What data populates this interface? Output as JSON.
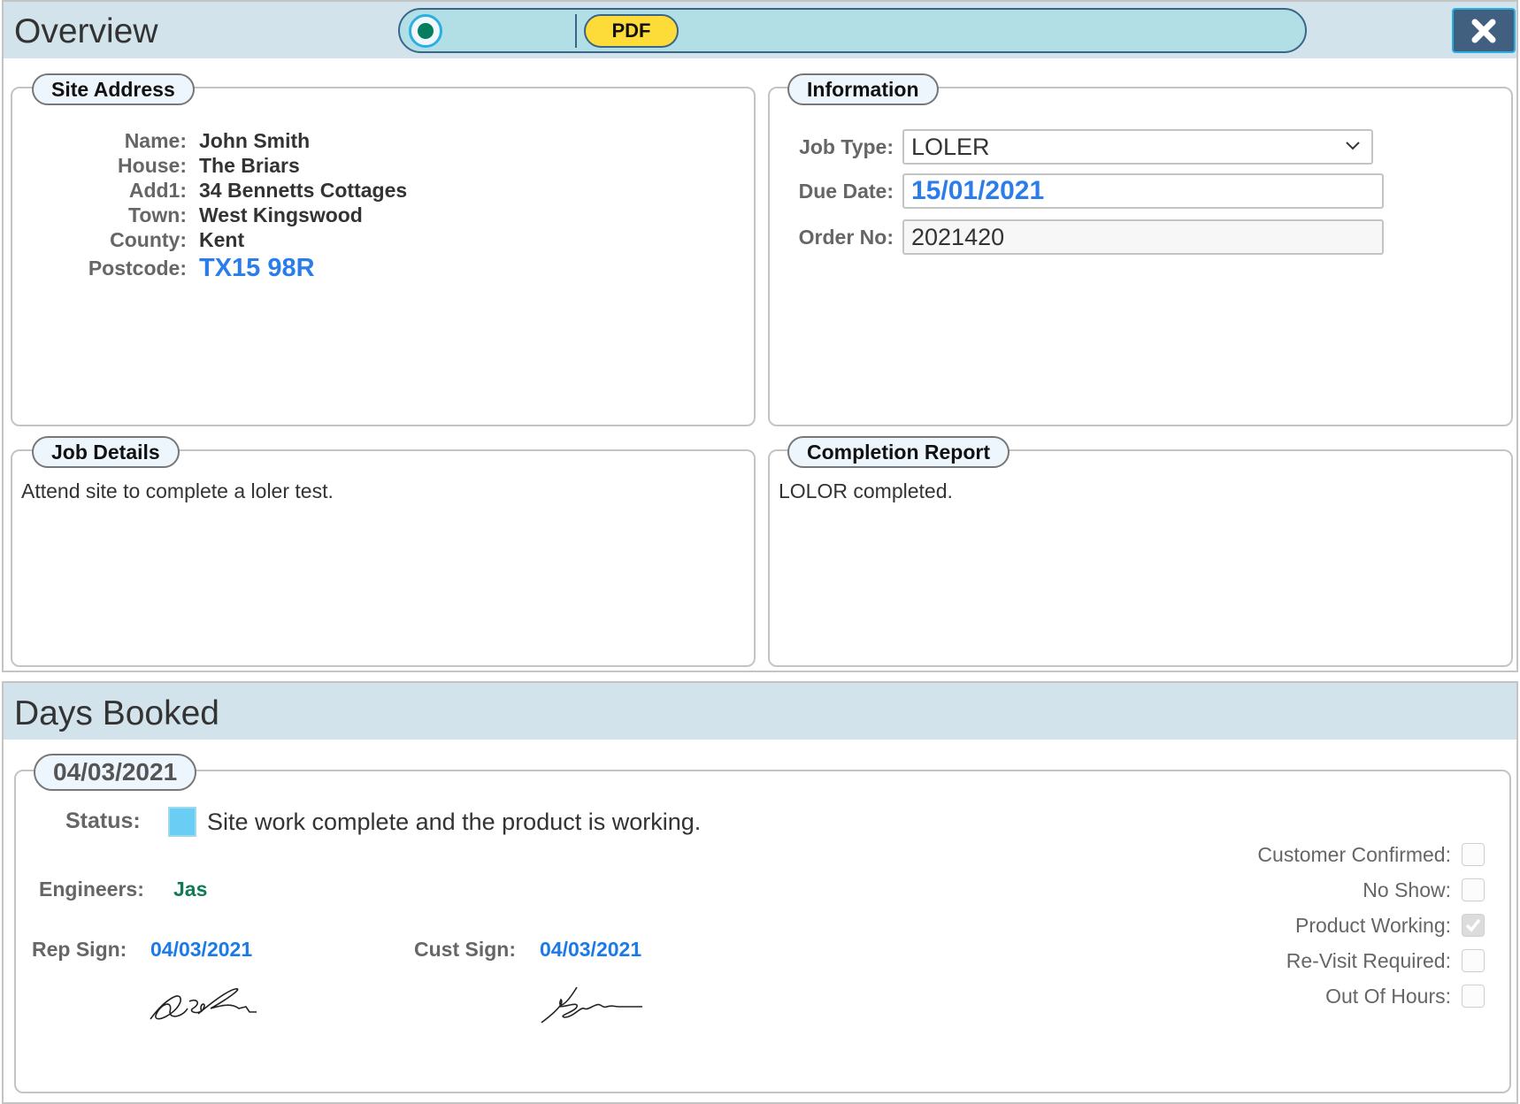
{
  "overview": {
    "title": "Overview",
    "toolbar": {
      "pdf_label": "PDF",
      "radio_icon": "radio-selected-icon"
    },
    "close_icon": "close-icon"
  },
  "site_address": {
    "legend": "Site Address",
    "rows": [
      {
        "label": "Name:",
        "value": "John Smith"
      },
      {
        "label": "House:",
        "value": "The Briars"
      },
      {
        "label": "Add1:",
        "value": "34 Bennetts Cottages"
      },
      {
        "label": "Town:",
        "value": "West Kingswood"
      },
      {
        "label": "County:",
        "value": "Kent"
      },
      {
        "label": "Postcode:",
        "value": "TX15 98R"
      }
    ]
  },
  "information": {
    "legend": "Information",
    "job_type_label": "Job Type:",
    "job_type_value": "LOLER",
    "due_date_label": "Due Date:",
    "due_date_value": "15/01/2021",
    "order_no_label": "Order No:",
    "order_no_value": "2021420"
  },
  "job_details": {
    "legend": "Job Details",
    "text": "Attend site to complete a loler test."
  },
  "completion_report": {
    "legend": "Completion Report",
    "text": "LOLOR completed."
  },
  "days_booked": {
    "title": "Days Booked",
    "day": {
      "date": "04/03/2021",
      "status_label": "Status:",
      "status_color": "#69cdf4",
      "status_text": "Site work complete and the product is working.",
      "engineers_label": "Engineers:",
      "engineers_value": "Jas",
      "rep_sign_label": "Rep Sign:",
      "rep_sign_date": "04/03/2021",
      "cust_sign_label": "Cust Sign:",
      "cust_sign_date": "04/03/2021",
      "checkboxes": [
        {
          "label": "Customer Confirmed:",
          "checked": false
        },
        {
          "label": "No Show:",
          "checked": false
        },
        {
          "label": "Product Working:",
          "checked": true
        },
        {
          "label": "Re-Visit Required:",
          "checked": false
        },
        {
          "label": "Out Of Hours:",
          "checked": false
        }
      ]
    }
  },
  "colors": {
    "header_bg": "#d3e3eb",
    "toolbar_bg": "#b1dfe5",
    "pdf_button": "#fddc3a",
    "close_button": "#41607f",
    "link_blue": "#2b7de9",
    "engineer_green": "#0f7a5a"
  }
}
